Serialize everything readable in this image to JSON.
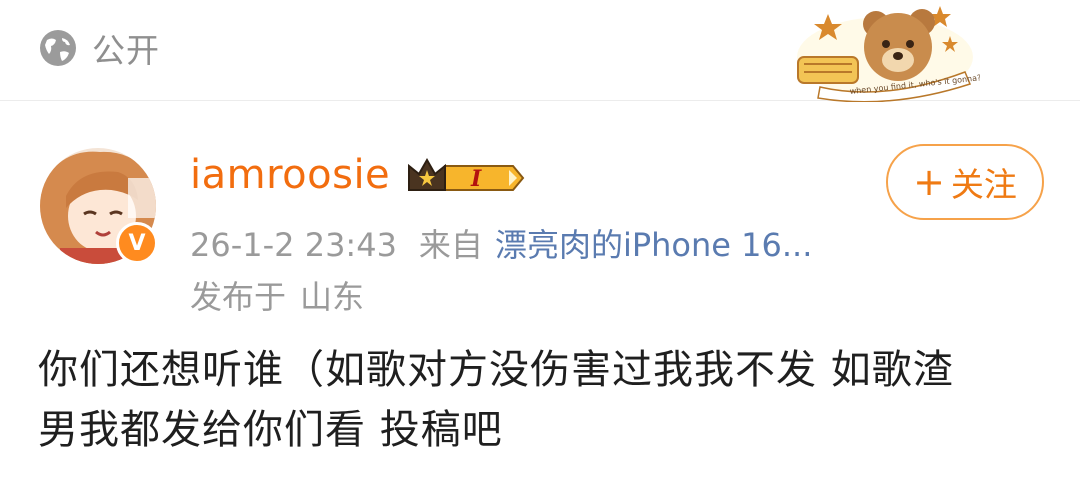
{
  "header": {
    "visibility_icon": "globe-icon",
    "visibility_label": "公开"
  },
  "sticker": {
    "icon": "teddy-bear-sticker",
    "banner_text": "when you find it, who's it gonna?"
  },
  "author": {
    "username": "iamroosie",
    "rank_badge_label": "I",
    "verified_mark": "V",
    "avatar_icon": "anime-girl-avatar"
  },
  "meta": {
    "timestamp": "26-1-2 23:43",
    "from_label": "来自",
    "device": "漂亮肉的iPhone 16...",
    "location_prefix": "发布于",
    "location": "山东"
  },
  "actions": {
    "follow_plus": "+",
    "follow_label": "关注"
  },
  "post": {
    "line1": "你们还想听谁（如歌对方没伤害过我我不发 如歌渣",
    "line2": "男我都发给你们看 投稿吧"
  },
  "colors": {
    "accent": "#f26d0f",
    "link": "#5a7bb0",
    "muted": "#9a9a9a",
    "follow_border": "#f6a24a"
  }
}
